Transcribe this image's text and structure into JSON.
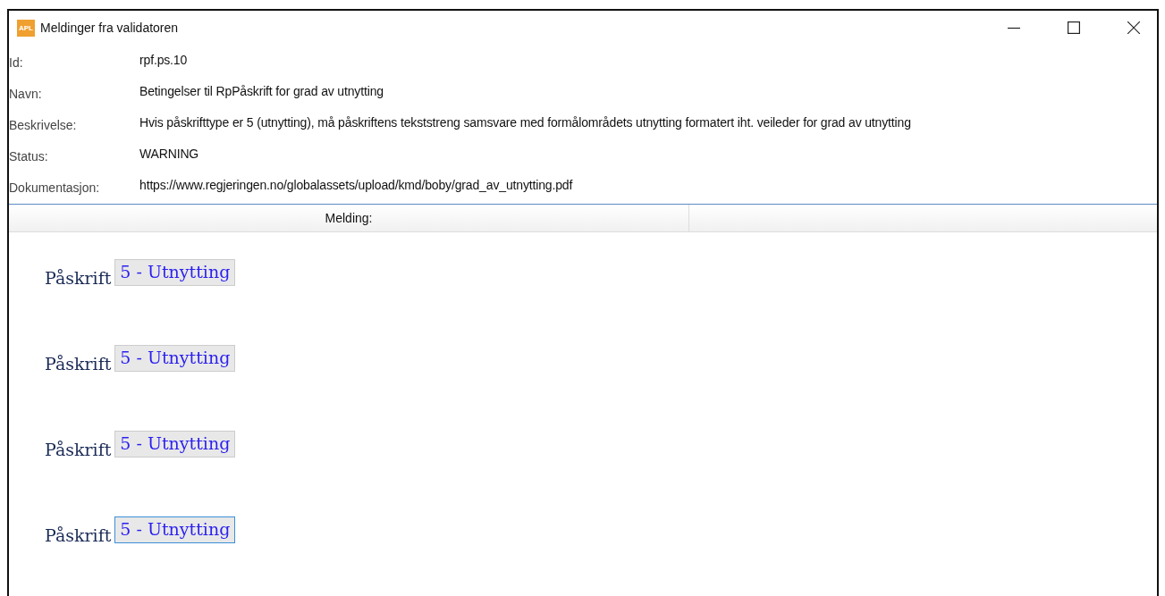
{
  "window": {
    "title": "Meldinger fra validatoren",
    "app_badge": "APL"
  },
  "fields": [
    {
      "label": "Id:",
      "value": "rpf.ps.10"
    },
    {
      "label": "Navn:",
      "value": "Betingelser til RpPåskrift for grad av utnytting"
    },
    {
      "label": "Beskrivelse:",
      "value": "Hvis påskrifttype er 5 (utnytting), må påskriftens tekststreng samsvare med formålområdets utnytting formatert iht. veileder for grad av utnytting"
    },
    {
      "label": "Status:",
      "value": "WARNING"
    },
    {
      "label": "Dokumentasjon:",
      "value": "https://www.regjeringen.no/globalassets/upload/kmd/boby/grad_av_utnytting.pdf"
    }
  ],
  "table": {
    "columns": [
      "Melding:"
    ]
  },
  "messages": [
    {
      "label": "Påskrift",
      "button": "5 - Utnytting",
      "focused": false
    },
    {
      "label": "Påskrift",
      "button": "5 - Utnytting",
      "focused": false
    },
    {
      "label": "Påskrift",
      "button": "5 - Utnytting",
      "focused": false
    },
    {
      "label": "Påskrift",
      "button": "5 - Utnytting",
      "focused": true
    }
  ]
}
